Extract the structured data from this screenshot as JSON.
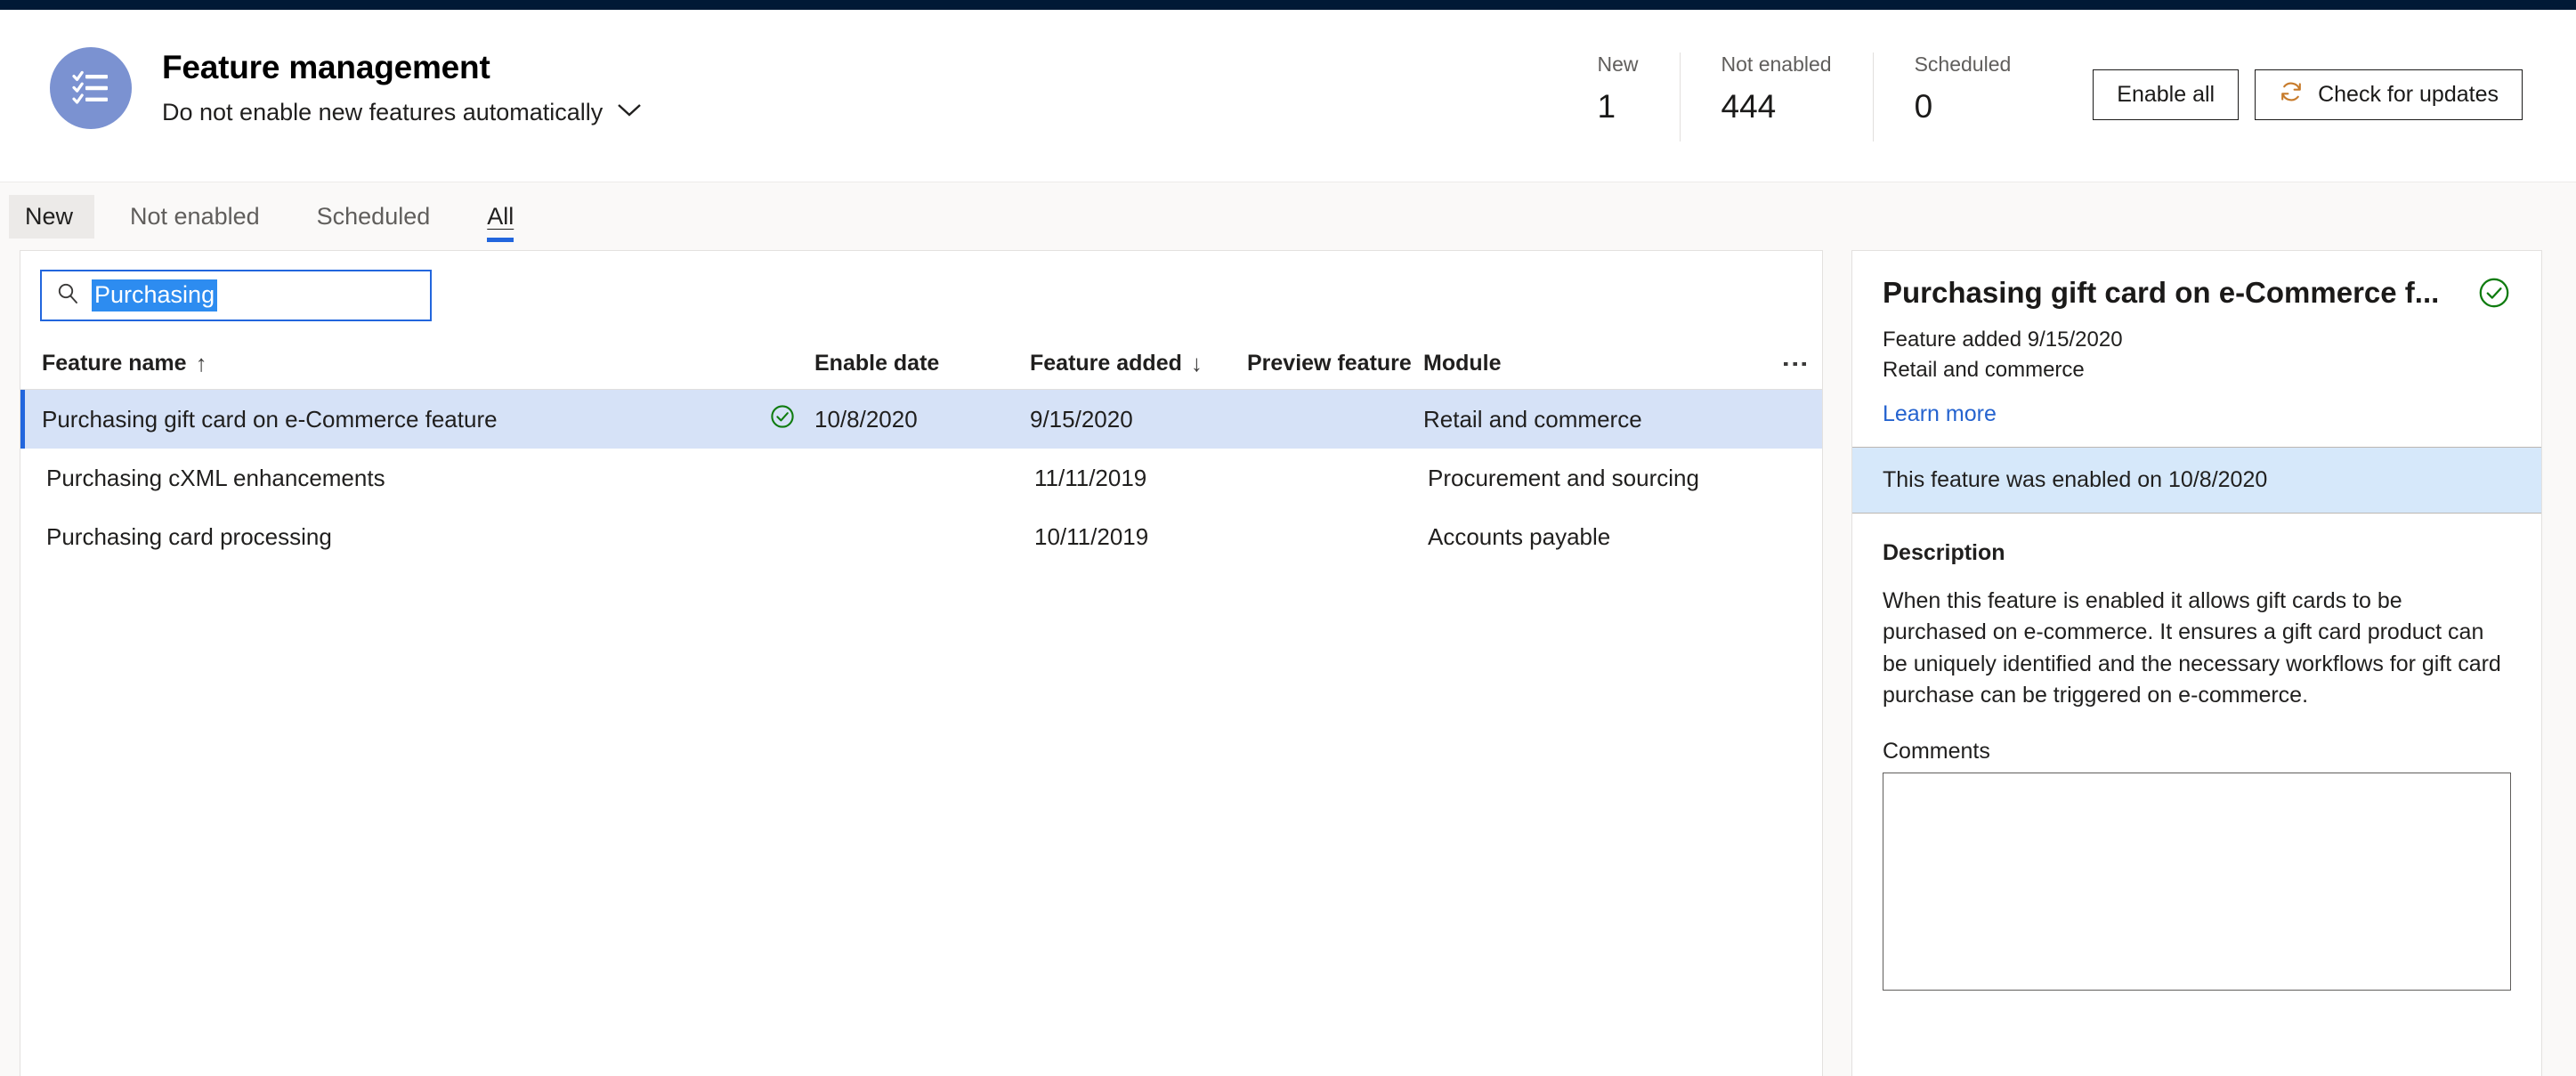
{
  "header": {
    "avatar_icon": "checklist-icon",
    "title": "Feature management",
    "subtitle": "Do not enable new features automatically",
    "subtitle_chevron_icon": "chevron-down-icon",
    "stats": [
      {
        "label": "New",
        "value": "1"
      },
      {
        "label": "Not enabled",
        "value": "444"
      },
      {
        "label": "Scheduled",
        "value": "0"
      }
    ],
    "actions": {
      "enable_all_label": "Enable all",
      "check_updates_label": "Check for updates",
      "check_updates_icon": "refresh-icon"
    }
  },
  "tabs": [
    {
      "label": "New",
      "state": "hover"
    },
    {
      "label": "Not enabled",
      "state": "default"
    },
    {
      "label": "Scheduled",
      "state": "default"
    },
    {
      "label": "All",
      "state": "active"
    }
  ],
  "search": {
    "icon": "search-icon",
    "value": "Purchasing",
    "placeholder": "Filter",
    "selected": true
  },
  "grid": {
    "columns": [
      {
        "key": "name",
        "label": "Feature name",
        "sort": "ascending",
        "sort_glyph": "↑"
      },
      {
        "key": "status",
        "label": "",
        "sort": "none",
        "sort_glyph": ""
      },
      {
        "key": "enable",
        "label": "Enable date",
        "sort": "none",
        "sort_glyph": ""
      },
      {
        "key": "added",
        "label": "Feature added",
        "sort": "descending",
        "sort_glyph": "↓"
      },
      {
        "key": "preview",
        "label": "Preview feature",
        "sort": "none",
        "sort_glyph": ""
      },
      {
        "key": "module",
        "label": "Module",
        "sort": "none",
        "sort_glyph": ""
      }
    ],
    "overflow_menu_icon": "more-vertical-icon",
    "rows": [
      {
        "name": "Purchasing gift card on e-Commerce feature",
        "status_icon": "check-circle-icon",
        "enable_date": "10/8/2020",
        "feature_added": "9/15/2020",
        "preview_feature": "",
        "module": "Retail and commerce",
        "selected": true
      },
      {
        "name": "Purchasing cXML enhancements",
        "status_icon": "",
        "enable_date": "",
        "feature_added": "11/11/2019",
        "preview_feature": "",
        "module": "Procurement and sourcing",
        "selected": false
      },
      {
        "name": "Purchasing card processing",
        "status_icon": "",
        "enable_date": "",
        "feature_added": "10/11/2019",
        "preview_feature": "",
        "module": "Accounts payable",
        "selected": false
      }
    ]
  },
  "detail": {
    "title": "Purchasing gift card on e-Commerce f...",
    "status_icon": "check-circle-icon",
    "feature_added": "Feature added 9/15/2020",
    "module": "Retail and commerce",
    "learn_more_label": "Learn more",
    "status_banner": "This feature was enabled on 10/8/2020",
    "description_label": "Description",
    "description": "When this feature is enabled it allows gift cards to be purchased on e-commerce. It ensures a gift card product can be uniquely identified and the necessary workflows for gift card purchase can be triggered on e-commerce.",
    "comments_label": "Comments",
    "comments_value": "",
    "comments_placeholder": ""
  },
  "colors": {
    "accent": "#2266dd",
    "top_strip": "#011936",
    "avatar": "#7b92d1",
    "status_success": "#107c10",
    "selected_row": "#d6e2f7",
    "banner": "#d6e8fa",
    "link": "#2563cf",
    "page_bg": "#faf9f8",
    "refresh_icon": "#c77b2b"
  }
}
